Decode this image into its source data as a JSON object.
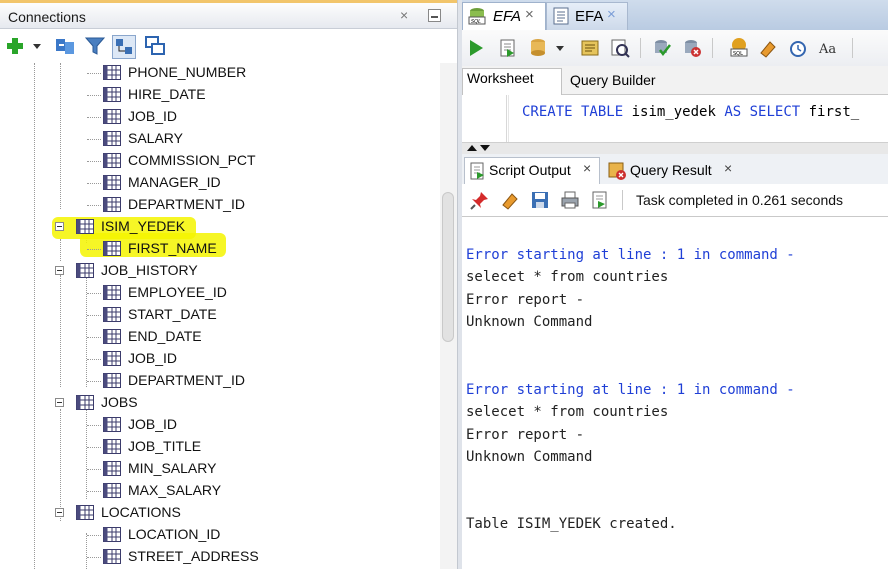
{
  "connections_panel": {
    "title": "Connections",
    "close_glyph": "×"
  },
  "tree": {
    "items": [
      {
        "label": "PHONE_NUMBER",
        "level": 2
      },
      {
        "label": "HIRE_DATE",
        "level": 2
      },
      {
        "label": "JOB_ID",
        "level": 2
      },
      {
        "label": "SALARY",
        "level": 2
      },
      {
        "label": "COMMISSION_PCT",
        "level": 2
      },
      {
        "label": "MANAGER_ID",
        "level": 2
      },
      {
        "label": "DEPARTMENT_ID",
        "level": 2
      },
      {
        "label": "ISIM_YEDEK",
        "level": 1,
        "highlighted": true
      },
      {
        "label": "FIRST_NAME",
        "level": 2,
        "highlighted": true
      },
      {
        "label": "JOB_HISTORY",
        "level": 1
      },
      {
        "label": "EMPLOYEE_ID",
        "level": 2
      },
      {
        "label": "START_DATE",
        "level": 2
      },
      {
        "label": "END_DATE",
        "level": 2
      },
      {
        "label": "JOB_ID",
        "level": 2
      },
      {
        "label": "DEPARTMENT_ID",
        "level": 2
      },
      {
        "label": "JOBS",
        "level": 1
      },
      {
        "label": "JOB_ID",
        "level": 2
      },
      {
        "label": "JOB_TITLE",
        "level": 2
      },
      {
        "label": "MIN_SALARY",
        "level": 2
      },
      {
        "label": "MAX_SALARY",
        "level": 2
      },
      {
        "label": "LOCATIONS",
        "level": 1
      },
      {
        "label": "LOCATION_ID",
        "level": 2
      },
      {
        "label": "STREET_ADDRESS",
        "level": 2
      }
    ]
  },
  "editor_tabs": [
    {
      "label": "EFA",
      "close": "×"
    },
    {
      "label": "EFA",
      "close": "×"
    }
  ],
  "worksheet_tabs": [
    "Worksheet",
    "Query Builder"
  ],
  "sql": {
    "kw1": "CREATE TABLE",
    "t1": " isim_yedek ",
    "kw2": "AS SELECT",
    "t2": " first_"
  },
  "output_tabs": [
    {
      "label": "Script Output",
      "close": "×"
    },
    {
      "label": "Query Result",
      "close": "×"
    }
  ],
  "task_status": "Task completed in 0.261 seconds",
  "output_lines": [
    {
      "text": "Error starting at line : 1 in command -",
      "blue": true
    },
    {
      "text": "selecet * from countries",
      "blue": false
    },
    {
      "text": "Error report -",
      "blue": false
    },
    {
      "text": "Unknown Command",
      "blue": false
    },
    {
      "text": "Error starting at line : 1 in command -",
      "blue": true
    },
    {
      "text": "selecet * from countries",
      "blue": false
    },
    {
      "text": "Error report -",
      "blue": false
    },
    {
      "text": "Unknown Command",
      "blue": false
    },
    {
      "text": "Table ISIM_YEDEK created.",
      "blue": false
    }
  ],
  "colors": {
    "highlight": "#f4f400",
    "keyword_blue": "#1f3fd6"
  }
}
